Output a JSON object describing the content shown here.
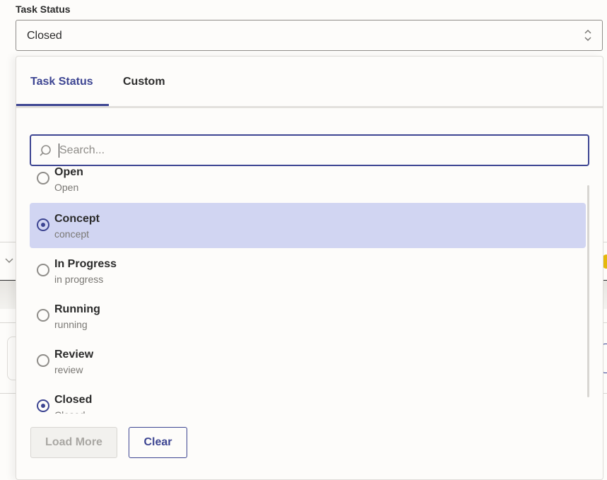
{
  "field": {
    "label": "Task Status",
    "selected_value": "Closed"
  },
  "popover": {
    "tabs": [
      {
        "label": "Task Status",
        "active": true
      },
      {
        "label": "Custom",
        "active": false
      }
    ],
    "search": {
      "value": "",
      "placeholder": "Search..."
    },
    "options": [
      {
        "title": "Open",
        "subtitle": "Open",
        "checked": false,
        "highlighted": false
      },
      {
        "title": "Concept",
        "subtitle": "concept",
        "checked": true,
        "highlighted": true
      },
      {
        "title": "In Progress",
        "subtitle": "in progress",
        "checked": false,
        "highlighted": false
      },
      {
        "title": "Running",
        "subtitle": "running",
        "checked": false,
        "highlighted": false
      },
      {
        "title": "Review",
        "subtitle": "review",
        "checked": false,
        "highlighted": false
      },
      {
        "title": "Closed",
        "subtitle": "Closed",
        "checked": true,
        "highlighted": false
      }
    ],
    "buttons": {
      "load_more": "Load More",
      "clear": "Clear"
    }
  },
  "colors": {
    "accent": "#3d4592",
    "highlight": "#d1d5f2",
    "background": "#fdfcfa"
  }
}
